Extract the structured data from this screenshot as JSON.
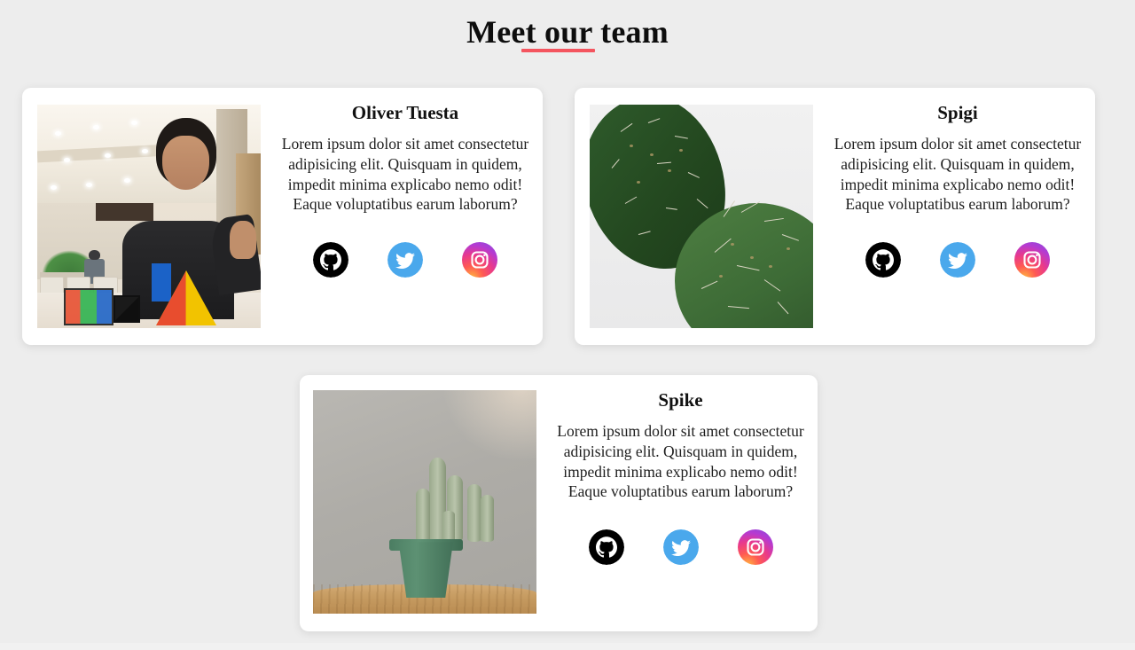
{
  "page": {
    "title": "Meet our team",
    "background_color": "#ededed",
    "accent_color": "#f4555f"
  },
  "team": {
    "members": [
      {
        "name": "Oliver Tuesta",
        "bio": "Lorem ipsum dolor sit amet consectetur adipisicing elit. Quisquam in quidem, impedit minima explicabo nemo odit! Eaque voluptatibus earum laborum?",
        "photo_alt": "portrait-photo-person-with-rubiks-cubes",
        "socials": [
          {
            "name": "github",
            "label": "GitHub",
            "color": "#000000"
          },
          {
            "name": "twitter",
            "label": "Twitter",
            "color": "#4aa8ec"
          },
          {
            "name": "instagram",
            "label": "Instagram",
            "color": "#e8398c"
          }
        ]
      },
      {
        "name": "Spigi",
        "bio": "Lorem ipsum dolor sit amet consectetur adipisicing elit. Quisquam in quidem, impedit minima explicabo nemo odit! Eaque voluptatibus earum laborum?",
        "photo_alt": "prickly-pear-cactus-closeup",
        "socials": [
          {
            "name": "github",
            "label": "GitHub",
            "color": "#000000"
          },
          {
            "name": "twitter",
            "label": "Twitter",
            "color": "#4aa8ec"
          },
          {
            "name": "instagram",
            "label": "Instagram",
            "color": "#e8398c"
          }
        ]
      },
      {
        "name": "Spike",
        "bio": "Lorem ipsum dolor sit amet consectetur adipisicing elit. Quisquam in quidem, impedit minima explicabo nemo odit! Eaque voluptatibus earum laborum?",
        "photo_alt": "potted-cactus-on-wooden-table",
        "socials": [
          {
            "name": "github",
            "label": "GitHub",
            "color": "#000000"
          },
          {
            "name": "twitter",
            "label": "Twitter",
            "color": "#4aa8ec"
          },
          {
            "name": "instagram",
            "label": "Instagram",
            "color": "#e8398c"
          }
        ]
      }
    ]
  }
}
